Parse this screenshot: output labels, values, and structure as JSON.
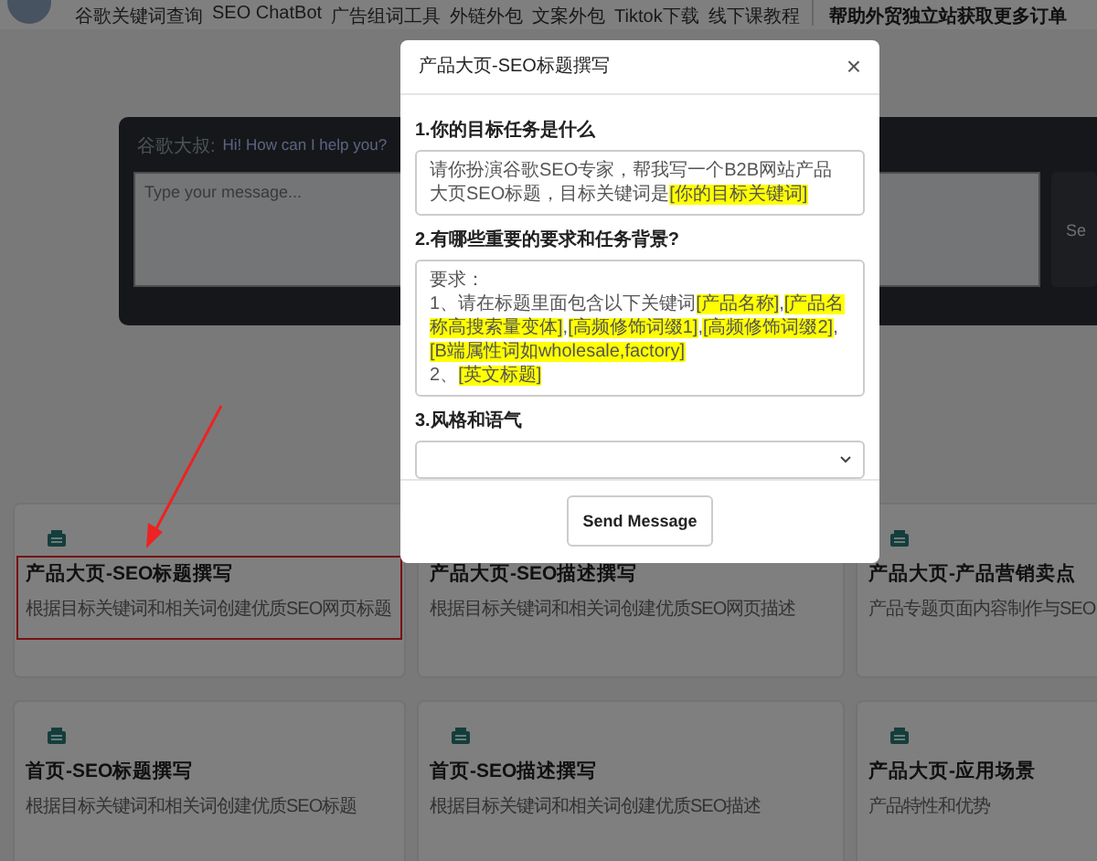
{
  "nav": {
    "items": [
      "谷歌关键词查询",
      "SEO ChatBot",
      "广告组词工具",
      "外链外包",
      "文案外包",
      "Tiktok下载",
      "线下课教程"
    ],
    "slogan": "帮助外贸独立站获取更多订单"
  },
  "chat": {
    "speaker": "谷歌大叔:",
    "greeting": "Hi! How can I help you?",
    "input_placeholder": "Type your message...",
    "send_label": "Se"
  },
  "cards": [
    {
      "title": "产品大页-SEO标题撰写",
      "description": [
        "根据目标关键词和相关词创建优质SEO网页标题"
      ],
      "annotated": true
    },
    {
      "title": "产品大页-SEO描述撰写",
      "description": [
        "根据目标关键词和相关词创建优质SEO网页描述"
      ],
      "annotated": false,
      "icon": false
    },
    {
      "title": "产品大页-产品营销卖点",
      "description": [
        "产品专题页面内容制作与SEO"
      ],
      "annotated": false
    },
    {
      "title": "首页-SEO标题撰写",
      "description": [
        "根据目标关键词和相关词创建优质SEO标题"
      ],
      "annotated": false
    },
    {
      "title": "首页-SEO描述撰写",
      "description": [
        "根据目标关键词和相关词创建优质SEO描述"
      ],
      "annotated": false
    },
    {
      "title": "产品大页-应用场景",
      "description": [
        "产品特性和优势"
      ],
      "annotated": false
    }
  ],
  "modal": {
    "title": "产品大页-SEO标题撰写",
    "close": "×",
    "fields": [
      {
        "kind": "text",
        "label": "1.你的目标任务是什么",
        "lines": [
          [
            {
              "text": "请你扮演谷歌SEO专家，帮我写一个B2B网站产品大页SEO标题，目标关键词是",
              "highlighted": false
            },
            {
              "text": "[你的目标关键词]",
              "highlighted": true
            }
          ]
        ]
      },
      {
        "kind": "text",
        "label": "2.有哪些重要的要求和任务背景?",
        "lines": [
          [
            {
              "text": "要求：",
              "highlighted": false
            }
          ],
          [
            {
              "text": "1、请在标题里面包含以下关键词",
              "highlighted": false
            },
            {
              "text": "[产品名称]",
              "highlighted": true
            },
            {
              "text": ",",
              "highlighted": false
            },
            {
              "text": "[产品名称高搜索量变体]",
              "highlighted": true
            },
            {
              "text": ",",
              "highlighted": false
            },
            {
              "text": "[高频修饰词缀1]",
              "highlighted": true
            },
            {
              "text": ",",
              "highlighted": false
            },
            {
              "text": "[高频修饰词缀2]",
              "highlighted": true
            },
            {
              "text": ",",
              "highlighted": false
            },
            {
              "text": "[B端属性词如wholesale,factory]",
              "highlighted": true
            }
          ],
          [
            {
              "text": "2、",
              "highlighted": false
            },
            {
              "text": "[英文标题]",
              "highlighted": true
            }
          ]
        ]
      },
      {
        "kind": "select",
        "label": "3.风格和语气"
      }
    ],
    "submit": "Send Message"
  }
}
